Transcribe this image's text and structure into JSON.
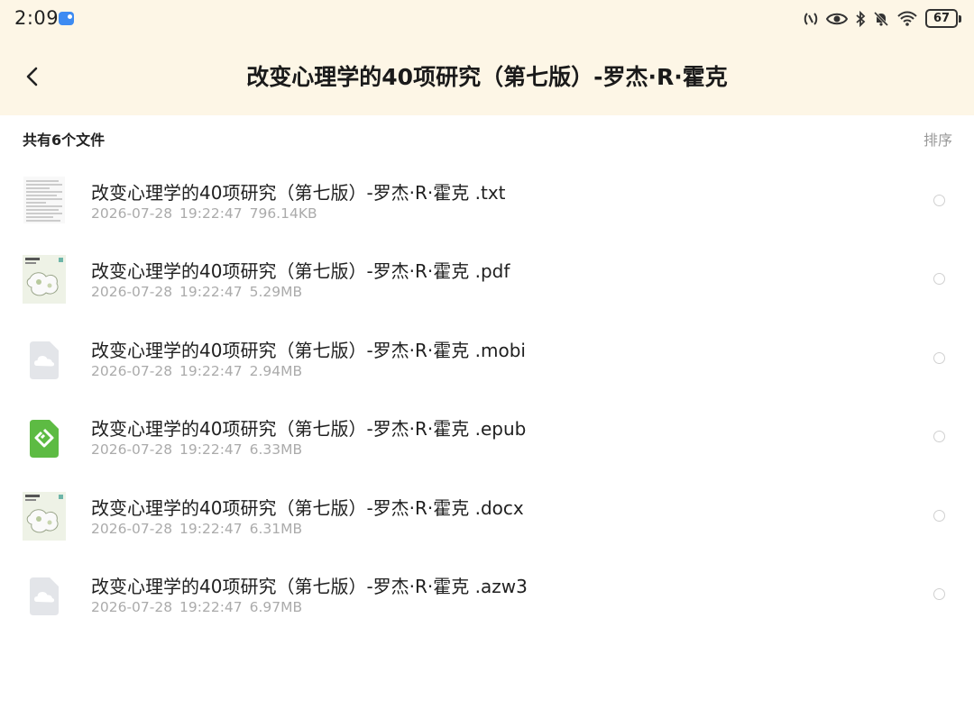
{
  "status_bar": {
    "time": "2:09",
    "battery": "67"
  },
  "header": {
    "back_icon": "chevron-left-icon",
    "title": "改变心理学的40项研究（第七版）-罗杰·R·霍克"
  },
  "toolbar": {
    "count_label": "共有6个文件",
    "sort_label": "排序"
  },
  "files": [
    {
      "name": "改变心理学的40项研究（第七版）-罗杰·R·霍克 .txt",
      "date": "2026-07-28",
      "time": "19:22:47",
      "size": "796.14KB",
      "icon": "text-document-thumbnail"
    },
    {
      "name": "改变心理学的40项研究（第七版）-罗杰·R·霍克 .pdf",
      "date": "2026-07-28",
      "time": "19:22:47",
      "size": "5.29MB",
      "icon": "book-cover-thumbnail"
    },
    {
      "name": "改变心理学的40项研究（第七版）-罗杰·R·霍克 .mobi",
      "date": "2026-07-28",
      "time": "19:22:47",
      "size": "2.94MB",
      "icon": "cloud-file-icon"
    },
    {
      "name": "改变心理学的40项研究（第七版）-罗杰·R·霍克 .epub",
      "date": "2026-07-28",
      "time": "19:22:47",
      "size": "6.33MB",
      "icon": "epub-icon"
    },
    {
      "name": "改变心理学的40项研究（第七版）-罗杰·R·霍克 .docx",
      "date": "2026-07-28",
      "time": "19:22:47",
      "size": "6.31MB",
      "icon": "book-cover-thumbnail"
    },
    {
      "name": "改变心理学的40项研究（第七版）-罗杰·R·霍克 .azw3",
      "date": "2026-07-28",
      "time": "19:22:47",
      "size": "6.97MB",
      "icon": "cloud-file-icon"
    }
  ],
  "colors": {
    "header_bg": "#fdf6e6",
    "epub_green": "#5dbb43",
    "meta_gray": "#ababab"
  }
}
